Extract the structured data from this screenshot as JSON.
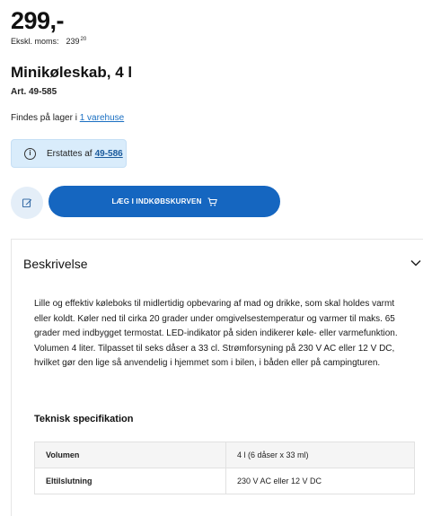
{
  "product": {
    "price": "299,-",
    "ex_vat_label": "Ekskl. moms:",
    "ex_vat_main": "239",
    "ex_vat_cents": "20",
    "title": "Minikøleskab, 4 l",
    "art_no": "Art. 49-585"
  },
  "stock": {
    "text": "Findes på lager i",
    "link": "1 varehuse"
  },
  "replacement": {
    "icon": "info-icon",
    "text": "Erstattes af",
    "link": "49-586"
  },
  "actions": {
    "edit_icon": "pencil-icon",
    "add_to_cart_label": "LÆG I INDKØBSKURVEN",
    "cart_icon": "cart-icon",
    "accent_color": "#1566c0"
  },
  "description": {
    "heading": "Beskrivelse",
    "body": "Lille og effektiv køleboks til midlertidig opbevaring af mad og drikke, som skal holdes varmt eller koldt. Køler ned til cirka 20 grader under omgivelsestemperatur og varmer til maks. 65 grader med indbygget termostat. LED-indikator på siden indikerer køle- eller varmefunktion. Volumen 4 liter. Tilpasset til seks dåser a 33 cl. Strømforsyning på 230 V AC eller 12 V DC, hvilket gør den lige så anvendelig i hjemmet som i bilen, i båden eller på campingturen."
  },
  "specs": {
    "title": "Teknisk specifikation",
    "rows": [
      {
        "key": "Volumen",
        "value": "4 l (6 dåser x 33 ml)"
      },
      {
        "key": "Eltilslutning",
        "value": "230 V AC eller 12 V DC"
      }
    ]
  }
}
